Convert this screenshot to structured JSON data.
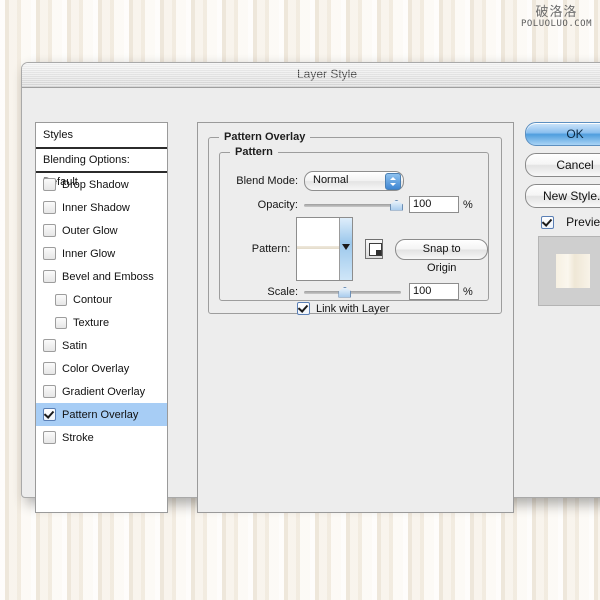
{
  "watermark": {
    "cn": "破洛洛",
    "en": "POLUOLUO.COM"
  },
  "dialog": {
    "title": "Layer Style"
  },
  "styles_panel": {
    "header": "Styles",
    "blending_options": "Blending Options: Default",
    "items": [
      {
        "label": "Drop Shadow",
        "checked": false,
        "indent": false,
        "selected": false
      },
      {
        "label": "Inner Shadow",
        "checked": false,
        "indent": false,
        "selected": false
      },
      {
        "label": "Outer Glow",
        "checked": false,
        "indent": false,
        "selected": false
      },
      {
        "label": "Inner Glow",
        "checked": false,
        "indent": false,
        "selected": false
      },
      {
        "label": "Bevel and Emboss",
        "checked": false,
        "indent": false,
        "selected": false
      },
      {
        "label": "Contour",
        "checked": false,
        "indent": true,
        "selected": false
      },
      {
        "label": "Texture",
        "checked": false,
        "indent": true,
        "selected": false
      },
      {
        "label": "Satin",
        "checked": false,
        "indent": false,
        "selected": false
      },
      {
        "label": "Color Overlay",
        "checked": false,
        "indent": false,
        "selected": false
      },
      {
        "label": "Gradient Overlay",
        "checked": false,
        "indent": false,
        "selected": false
      },
      {
        "label": "Pattern Overlay",
        "checked": true,
        "indent": false,
        "selected": true
      },
      {
        "label": "Stroke",
        "checked": false,
        "indent": false,
        "selected": false
      }
    ]
  },
  "options_panel": {
    "outer_group_legend": "Pattern Overlay",
    "inner_group_legend": "Pattern",
    "blend_mode": {
      "label": "Blend Mode:",
      "value": "Normal"
    },
    "opacity": {
      "label": "Opacity:",
      "value": "100",
      "unit": "%",
      "slider_percent": 100
    },
    "pattern": {
      "label": "Pattern:"
    },
    "snap_to_origin": "Snap to Origin",
    "scale": {
      "label": "Scale:",
      "value": "100",
      "unit": "%",
      "slider_percent": 40
    },
    "link_with_layer": {
      "label": "Link with Layer",
      "checked": true
    }
  },
  "buttons": {
    "ok": "OK",
    "cancel": "Cancel",
    "new_style": "New Style...",
    "preview": {
      "label": "Preview",
      "checked": true
    }
  },
  "colors": {
    "selection_blue": "#a7cdf5",
    "ok_button_blue": "#4f9ede",
    "dialog_gray": "#ededed",
    "wallpaper_beige": "#f5efe6"
  }
}
